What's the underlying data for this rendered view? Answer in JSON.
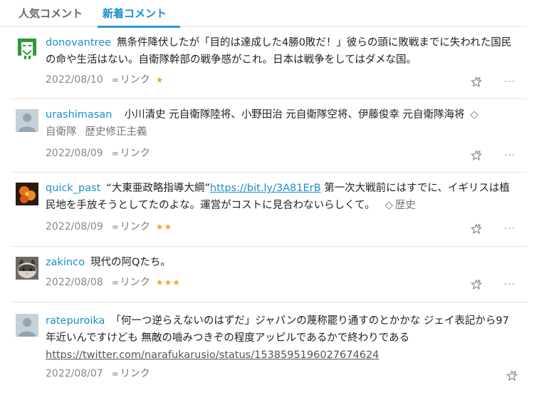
{
  "tabs": [
    {
      "label": "人気コメント"
    },
    {
      "label": "新着コメント"
    }
  ],
  "link_label": "リンク",
  "comments": [
    {
      "user": "donovantree",
      "text": "無条件降伏したが「目的は達成した4勝0敗だ！」彼らの頭に敗戦までに失われた国民の命や生活はない。自衛隊幹部の戦争感がこれ。日本は戦争をしてはダメな国。",
      "date": "2022/08/10",
      "stars": "★"
    },
    {
      "user": "urashimasan",
      "text": "小川清史 元自衛隊陸将、小野田治 元自衛隊空将、伊藤俊幸 元自衛隊海将",
      "tags": [
        "自衛隊",
        "歴史修正主義"
      ],
      "date": "2022/08/09",
      "stars": ""
    },
    {
      "user": "quick_past",
      "text_before": "“大東亜政略指導大綱”",
      "inline_link": "https://bit.ly/3A81ErB",
      "text_after": "第一次大戦前にはすでに、イギリスは植民地を手放そうとしてたのよな。運営がコストに見合わないらしくて。",
      "tag": "歴史",
      "date": "2022/08/09",
      "stars": "★★"
    },
    {
      "user": "zakinco",
      "text": "現代の阿Qたち。",
      "date": "2022/08/08",
      "stars": "★★★"
    },
    {
      "user": "ratepuroika",
      "text": "「何一つ逆らえないのはずだ」ジャパンの蔑称罷り通すのとかかな ジェイ表記から97年近いんですけども 無敵の嚙みつきぞの程度アッピルであるかで終わりである",
      "url": "https://twitter.com/narafukarusio/status/1538595196027674624",
      "date": "2022/08/07",
      "stars": ""
    }
  ],
  "colors": {
    "accent": "#1a8fc9",
    "star": "#f2a623",
    "meta": "#777777"
  },
  "icons": [
    "link-icon",
    "star-outline-icon",
    "more-dots-icon",
    "tag-icon"
  ]
}
